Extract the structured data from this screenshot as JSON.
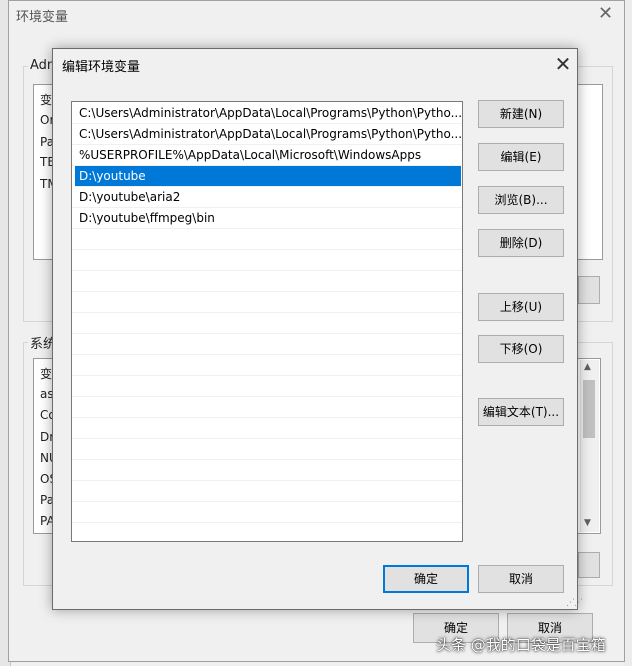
{
  "background_dialog": {
    "title": "环境变量",
    "user_group_label": "Adm",
    "user_list_header": "变",
    "user_rows": [
      "Or",
      "Pa",
      "TE",
      "TM"
    ],
    "system_group_label": "系统",
    "system_list_header": "变",
    "system_rows": [
      "as",
      "Co",
      "Dr",
      "NU",
      "OS",
      "Pa",
      "PA"
    ],
    "ok_label": "确定",
    "cancel_label": "取消"
  },
  "dialog": {
    "title": "编辑环境变量",
    "entries": [
      "C:\\Users\\Administrator\\AppData\\Local\\Programs\\Python\\Pytho...",
      "C:\\Users\\Administrator\\AppData\\Local\\Programs\\Python\\Pytho...",
      "%USERPROFILE%\\AppData\\Local\\Microsoft\\WindowsApps",
      "D:\\youtube",
      "D:\\youtube\\aria2",
      "D:\\youtube\\ffmpeg\\bin"
    ],
    "selected_index": 3,
    "buttons": {
      "new": "新建(N)",
      "edit": "编辑(E)",
      "browse": "浏览(B)...",
      "delete": "删除(D)",
      "move_up": "上移(U)",
      "move_down": "下移(O)",
      "edit_text": "编辑文本(T)...",
      "ok": "确定",
      "cancel": "取消"
    }
  },
  "watermark": "头条 @我的口袋是百宝箱",
  "colors": {
    "selection": "#0078d7",
    "default_button_border": "#0078d7"
  }
}
